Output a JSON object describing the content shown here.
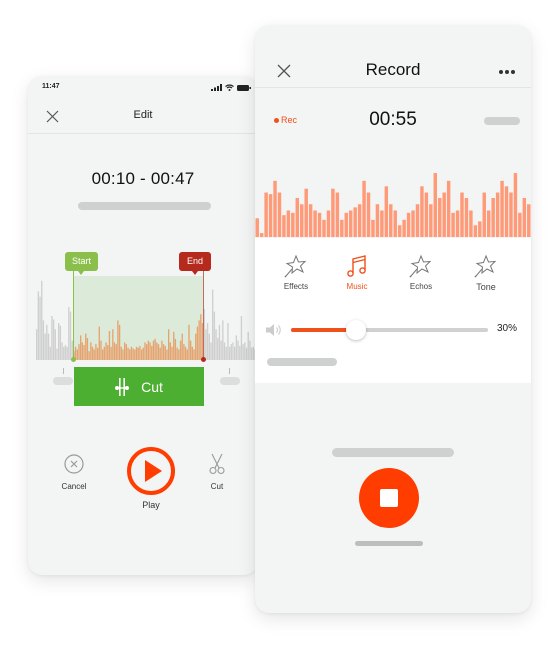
{
  "edit_screen": {
    "status_time": "11:47",
    "title": "Edit",
    "time_range": "00:10 - 00:47",
    "start_tag": "Start",
    "end_tag": "End",
    "cut_button": "Cut",
    "actions": [
      {
        "label": "Cancel",
        "icon": "cancel-circle-icon"
      },
      {
        "label": "Play",
        "icon": "play-icon"
      },
      {
        "label": "Cut",
        "icon": "scissors-icon"
      }
    ],
    "waveform_levels": [
      0.35,
      0.78,
      0.72,
      0.9,
      0.45,
      0.3,
      0.4,
      0.3,
      0.15,
      0.5,
      0.46,
      0.35,
      0.13,
      0.42,
      0.39,
      0.2,
      0.15,
      0.17,
      0.15,
      0.6,
      0.55,
      0.22,
      0.1,
      0.15,
      0.12,
      0.18,
      0.28,
      0.2,
      0.17,
      0.3,
      0.25,
      0.1,
      0.2,
      0.15,
      0.12,
      0.18,
      0.14,
      0.38,
      0.22,
      0.12,
      0.15,
      0.2,
      0.17,
      0.33,
      0.15,
      0.35,
      0.2,
      0.18,
      0.45,
      0.4,
      0.15,
      0.12,
      0.2,
      0.18,
      0.14,
      0.12,
      0.15,
      0.13,
      0.12,
      0.15,
      0.14,
      0.16,
      0.12,
      0.14,
      0.2,
      0.18,
      0.22,
      0.2,
      0.16,
      0.22,
      0.24,
      0.2,
      0.18,
      0.14,
      0.22,
      0.18,
      0.16,
      0.12,
      0.35,
      0.2,
      0.15,
      0.32,
      0.24,
      0.14,
      0.12,
      0.22,
      0.3,
      0.18,
      0.15,
      0.12,
      0.4,
      0.22,
      0.15,
      0.12,
      0.3,
      0.38,
      0.45,
      0.52,
      0.42,
      0.58,
      0.35,
      0.42,
      0.3,
      0.2,
      0.8,
      0.55,
      0.35,
      0.25,
      0.4,
      0.22,
      0.45,
      0.2,
      0.15,
      0.42,
      0.15,
      0.18,
      0.2,
      0.15,
      0.28,
      0.22,
      0.16,
      0.5,
      0.18,
      0.2,
      0.14,
      0.32,
      0.22,
      0.14,
      0.15,
      0.12
    ],
    "selection_start_fraction": 0.2,
    "selection_end_fraction": 0.76
  },
  "record_screen": {
    "title": "Record",
    "rec_label": "Rec",
    "elapsed": "00:55",
    "waveform_levels": [
      0.24,
      0.05,
      0.57,
      0.55,
      0.72,
      0.57,
      0.28,
      0.34,
      0.31,
      0.5,
      0.42,
      0.62,
      0.42,
      0.34,
      0.31,
      0.22,
      0.34,
      0.62,
      0.57,
      0.22,
      0.31,
      0.34,
      0.38,
      0.42,
      0.72,
      0.57,
      0.22,
      0.42,
      0.34,
      0.65,
      0.42,
      0.34,
      0.15,
      0.22,
      0.31,
      0.34,
      0.42,
      0.65,
      0.57,
      0.42,
      0.82,
      0.5,
      0.57,
      0.72,
      0.31,
      0.34,
      0.57,
      0.5,
      0.34,
      0.15,
      0.2,
      0.57,
      0.34,
      0.5,
      0.57,
      0.72,
      0.65,
      0.57,
      0.82,
      0.31,
      0.5,
      0.42
    ],
    "effects": [
      {
        "label": "Effects",
        "icon": "magic-star-icon",
        "active": false
      },
      {
        "label": "Music",
        "icon": "music-note-icon",
        "active": true
      },
      {
        "label": "Echos",
        "icon": "magic-star-icon",
        "active": false
      },
      {
        "label": "Tone",
        "icon": "magic-star-icon",
        "active": false
      }
    ],
    "volume_percent_label": "30%",
    "volume_value": 0.3
  },
  "colors": {
    "accent": "#f0501a",
    "record_red": "#ff3d00",
    "cut_green": "#4caf32",
    "start_green": "#8bbf4c",
    "end_red": "#b52a1c",
    "wave_orange": "#ff9a78",
    "selected_wave": "#e6a370",
    "unselected_wave": "#cfcfcf"
  }
}
